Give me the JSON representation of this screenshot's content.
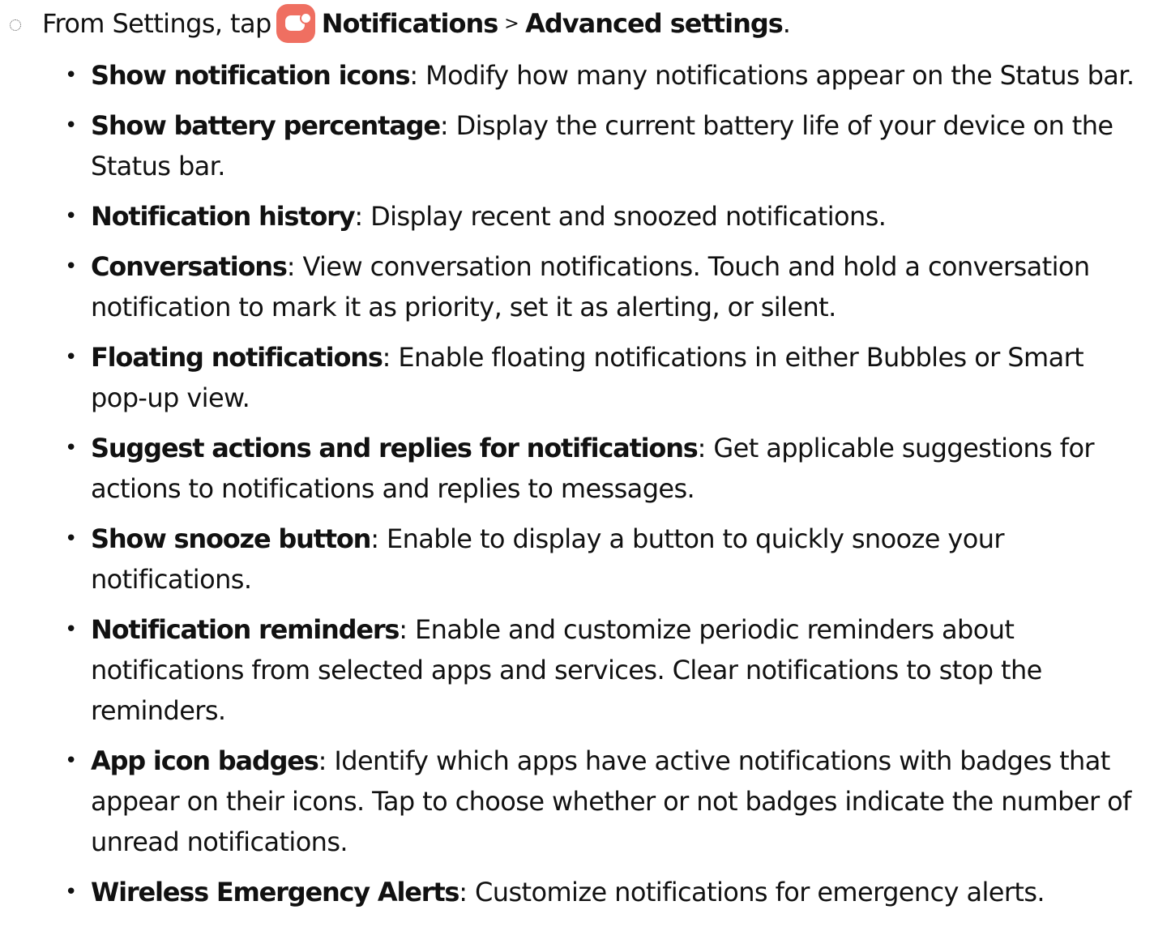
{
  "step": {
    "prefix": "From Settings, tap",
    "icon": "notifications-app-icon",
    "path_first": "Notifications",
    "separator": ">",
    "path_second": "Advanced settings",
    "suffix": "."
  },
  "options": [
    {
      "term": "Show notification icons",
      "description": ": Modify how many notifications appear on the Status bar."
    },
    {
      "term": "Show battery percentage",
      "description": ": Display the current battery life of your device on the Status bar."
    },
    {
      "term": "Notification history",
      "description": ": Display recent and snoozed notifications."
    },
    {
      "term": "Conversations",
      "description": ": View conversation notifications. Touch and hold a conversation notification to mark it as priority, set it as alerting, or silent."
    },
    {
      "term": "Floating notifications",
      "description": ": Enable floating notifications in either Bubbles or Smart pop-up view."
    },
    {
      "term": "Suggest actions and replies for notifications",
      "description": ": Get applicable suggestions for actions to notifications and replies to messages."
    },
    {
      "term": "Show snooze button",
      "description": ": Enable to display a button to quickly snooze your notifications."
    },
    {
      "term": "Notification reminders",
      "description": ": Enable and customize periodic reminders about notifications from selected apps and services. Clear notifications to stop the reminders."
    },
    {
      "term": "App icon badges",
      "description": ": Identify which apps have active notifications with badges that appear on their icons. Tap to choose whether or not badges indicate the number of unread notifications."
    },
    {
      "term": "Wireless Emergency Alerts",
      "description": ": Customize notifications for emergency alerts."
    }
  ],
  "colors": {
    "text": "#111111",
    "icon_background": "#ef6f61"
  }
}
